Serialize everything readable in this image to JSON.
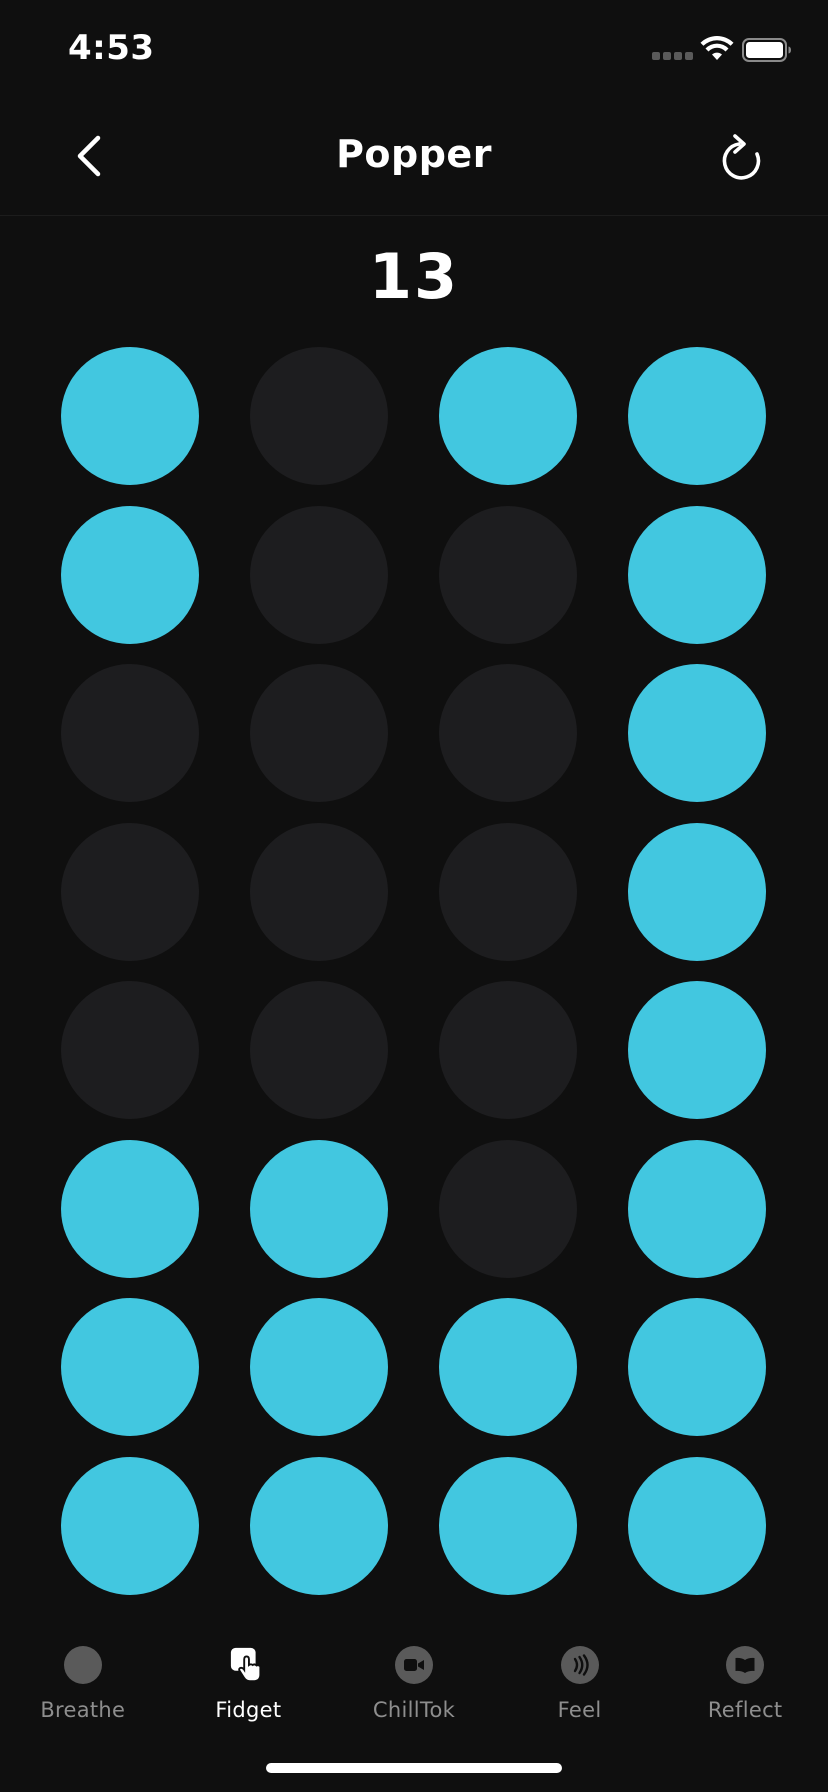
{
  "status_bar": {
    "time": "4:53"
  },
  "header": {
    "title": "Popper",
    "back_icon": "chevron-left-icon",
    "reset_icon": "refresh-icon"
  },
  "counter": {
    "value": "13"
  },
  "bubbles": {
    "columns": 4,
    "rows": 8,
    "colors": {
      "popped": "#42c7e0",
      "unpopped": "#1d1d1f"
    },
    "states": [
      [
        true,
        false,
        true,
        true
      ],
      [
        true,
        false,
        false,
        true
      ],
      [
        false,
        false,
        false,
        true
      ],
      [
        false,
        false,
        false,
        true
      ],
      [
        false,
        false,
        false,
        true
      ],
      [
        true,
        true,
        false,
        true
      ],
      [
        true,
        true,
        true,
        true
      ],
      [
        true,
        true,
        true,
        true
      ]
    ]
  },
  "tab_bar": {
    "tabs": [
      {
        "label": "Breathe",
        "icon": "circle-icon",
        "active": false
      },
      {
        "label": "Fidget",
        "icon": "hand-tap-icon",
        "active": true
      },
      {
        "label": "ChillTok",
        "icon": "video-camera-icon",
        "active": false
      },
      {
        "label": "Feel",
        "icon": "haptic-waves-icon",
        "active": false
      },
      {
        "label": "Reflect",
        "icon": "book-icon",
        "active": false
      }
    ]
  },
  "theme": {
    "background": "#0f0f0f",
    "accent": "#42c7e0"
  }
}
